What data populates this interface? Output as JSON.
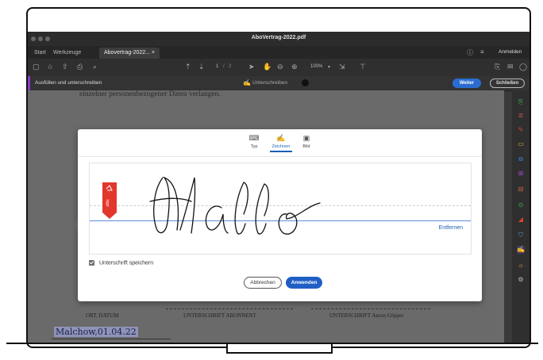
{
  "window": {
    "title": "AboVertrag-2022.pdf"
  },
  "tabs": [
    {
      "label": "Start"
    },
    {
      "label": "Werkzeuge"
    },
    {
      "label": "Abovertrag-2022... ×"
    }
  ],
  "topbar_right": {
    "signin_label": "Anmelden"
  },
  "toolbar": {
    "page_current": "1",
    "page_sep": "/",
    "page_total": "2",
    "zoom": "100%"
  },
  "fillsign": {
    "title": "Ausfüllen und unterschreiben",
    "sign_label": "Unterschreiben",
    "next_label": "Weiter",
    "close_label": "Schließen"
  },
  "doc": {
    "top_text": "einzelner personenbezogener Daten verlangen.",
    "place_date_handwritten": "Malchow,01.04.22",
    "place_date_label": "ORT, DATUM",
    "sig_subscriber_label": "UNTERSCHRIFT ABONNENT",
    "sig_provider_label": "UNTERSCHRIFT Aaron Göpper"
  },
  "dialog": {
    "tabs": [
      {
        "label": "Typ",
        "icon": "keyboard-icon"
      },
      {
        "label": "Zeichnen",
        "icon": "draw-pen-icon"
      },
      {
        "label": "Bild",
        "icon": "image-icon"
      }
    ],
    "active_tab": "Zeichnen",
    "remove_label": "Entfernen",
    "save_label": "Unterschrift speichern",
    "save_checked": true,
    "cancel_label": "Abbrechen",
    "apply_label": "Anwenden"
  },
  "colors": {
    "accent": "#1f5fc4",
    "flag": "#e2372b",
    "dark_ui": "#2f2f2f"
  }
}
